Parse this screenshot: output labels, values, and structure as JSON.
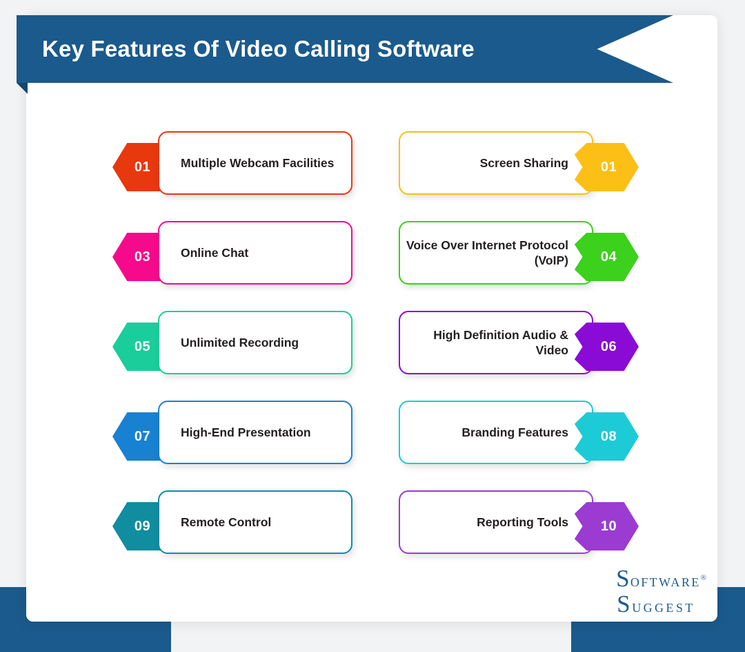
{
  "header": {
    "title": "Key Features Of Video Calling Software",
    "banner_color": "#1b5a8c"
  },
  "page": {
    "background": "#f2f3f4",
    "card_background": "#ffffff",
    "accent_color": "#1b5a8c"
  },
  "features": [
    {
      "number": "01",
      "label": "Multiple Webcam Facilities",
      "color": "#E8380D",
      "side": "left"
    },
    {
      "number": "01",
      "label": "Screen Sharing",
      "color": "#FBBF16",
      "side": "right"
    },
    {
      "number": "03",
      "label": "Online Chat",
      "color": "#F50A8C",
      "side": "left"
    },
    {
      "number": "04",
      "label": "Voice Over Internet Protocol (VoIP)",
      "color": "#3BD11C",
      "side": "right"
    },
    {
      "number": "05",
      "label": "Unlimited Recording",
      "color": "#19CE9A",
      "side": "left"
    },
    {
      "number": "06",
      "label": "High Definition Audio & Video",
      "color": "#8A0BD6",
      "side": "right"
    },
    {
      "number": "07",
      "label": "High-End Presentation",
      "color": "#1881D2",
      "side": "left"
    },
    {
      "number": "08",
      "label": "Branding Features",
      "color": "#1CCBD6",
      "side": "right"
    },
    {
      "number": "09",
      "label": "Remote Control",
      "color": "#118DA0",
      "side": "left"
    },
    {
      "number": "10",
      "label": "Reporting Tools",
      "color": "#9B3BD1",
      "side": "right"
    }
  ],
  "logo": {
    "cap1": "S",
    "word1": "OFTWARE",
    "registered": "®",
    "cap2": "S",
    "word2": "UGGEST"
  }
}
